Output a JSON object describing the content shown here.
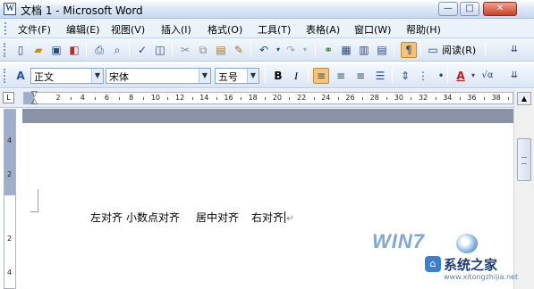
{
  "window": {
    "title": "文档 1 - Microsoft Word",
    "controls": {
      "minimize": "—",
      "maximize": "□",
      "close": "✕"
    }
  },
  "menu": {
    "items": [
      {
        "label": "文件(F)"
      },
      {
        "label": "编辑(E)"
      },
      {
        "label": "视图(V)"
      },
      {
        "label": "插入(I)"
      },
      {
        "label": "格式(O)"
      },
      {
        "label": "工具(T)"
      },
      {
        "label": "表格(A)"
      },
      {
        "label": "窗口(W)"
      },
      {
        "label": "帮助(H)"
      }
    ]
  },
  "standard_toolbar": {
    "read_label": "阅读(R)",
    "icons": [
      "new-document-icon",
      "open-folder-icon",
      "save-icon",
      "permission-icon",
      "print-icon",
      "print-preview-icon",
      "spelling-icon",
      "research-icon",
      "cut-icon",
      "copy-icon",
      "paste-icon",
      "format-painter-icon",
      "undo-icon",
      "redo-icon",
      "hyperlink-icon",
      "tables-borders-icon",
      "insert-table-icon",
      "show-hide-icon",
      "read-icon"
    ]
  },
  "formatting_toolbar": {
    "style": "正文",
    "font": "宋体",
    "size": "五号",
    "bold": "B",
    "italic": "I",
    "font_color_letter": "A",
    "phonetic": "√α"
  },
  "ruler": {
    "tab_selector": "L",
    "labels": [
      "2",
      "4",
      "6",
      "8",
      "10",
      "12",
      "14",
      "16",
      "18",
      "20",
      "22",
      "24",
      "26",
      "28",
      "30",
      "32",
      "34",
      "36",
      "38"
    ],
    "vertical_labels": [
      "4",
      "2",
      "2",
      "4"
    ]
  },
  "document": {
    "segments": [
      "左对齐",
      "小数点对齐",
      "居中对齐",
      "右对齐"
    ],
    "paragraph_mark": "↵"
  },
  "watermark": {
    "brand": "WIN7",
    "site": "系统之家",
    "url": "www.xitongzhijia.net",
    "site_icon": "⌂"
  },
  "colors": {
    "accent": "#f6c37a",
    "title_bar": "#dde8f5",
    "doc_background": "#8a93a5"
  }
}
